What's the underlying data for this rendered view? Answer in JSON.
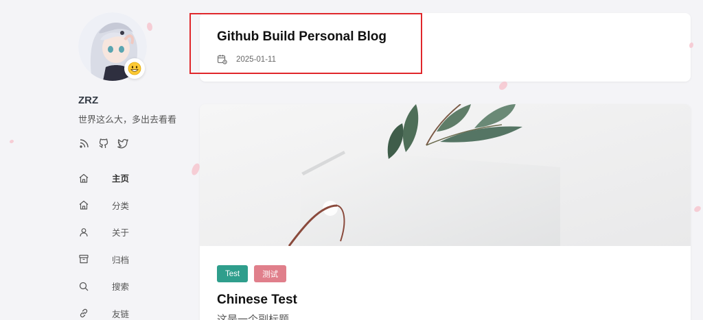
{
  "author": {
    "name": "ZRZ",
    "bio": "世界这么大，多出去看看",
    "avatar_badge": "😀"
  },
  "socials": [
    {
      "icon": "rss-icon"
    },
    {
      "icon": "github-icon"
    },
    {
      "icon": "twitter-icon"
    }
  ],
  "nav": [
    {
      "label": "主页",
      "icon": "home-icon",
      "active": true
    },
    {
      "label": "分类",
      "icon": "home-icon"
    },
    {
      "label": "关于",
      "icon": "user-icon"
    },
    {
      "label": "归档",
      "icon": "archive-icon"
    },
    {
      "label": "搜索",
      "icon": "search-icon"
    },
    {
      "label": "友链",
      "icon": "link-icon"
    }
  ],
  "posts": [
    {
      "title": "Github Build Personal Blog",
      "date": "2025-01-11"
    },
    {
      "tags": [
        {
          "label": "Test",
          "color": "#2f9e8c"
        },
        {
          "label": "测试",
          "color": "#e07f8b"
        }
      ],
      "title": "Chinese Test",
      "subtitle": "这是一个副标题"
    }
  ],
  "colors": {
    "background": "#f4f4f7",
    "highlight": "#e0262a"
  }
}
